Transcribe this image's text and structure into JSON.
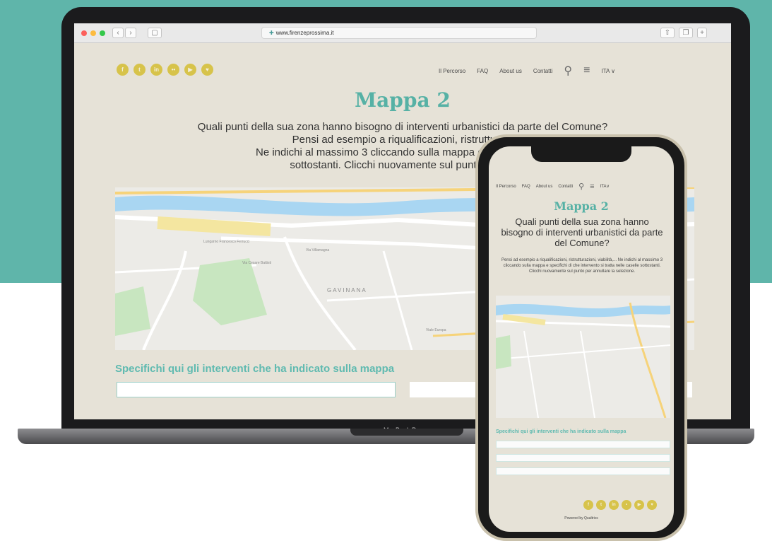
{
  "browser": {
    "url": "www.firenzeprossima.it"
  },
  "colors": {
    "accent": "#56b1a5",
    "social": "#d7c34a",
    "page_bg": "#e6e2d7",
    "teal_backdrop": "#5fb5aa"
  },
  "laptop": {
    "label": "MacBook Pro",
    "social_icons": [
      "facebook-icon",
      "twitter-icon",
      "linkedin-icon",
      "flickr-icon",
      "youtube-icon",
      "heart-icon"
    ],
    "nav": {
      "items": [
        "Il Percorso",
        "FAQ",
        "About us",
        "Contatti"
      ],
      "lang": "ITA",
      "lang_chevron": "∨"
    },
    "title": "Mappa 2",
    "text": {
      "line1": "Quali punti della sua zona hanno bisogno di interventi urbanistici da parte del Comune?",
      "line2": "Pensi ad esempio a riqualificazioni, ristrutturazi",
      "line3": "Ne indichi al massimo 3 cliccando sulla mappa e specifichi di c",
      "line4": "sottostanti. Clicchi nuovamente sul punto per an"
    },
    "map_labels": {
      "district": "GAVINANA",
      "street1": "Lungarno Francesco Ferrucci",
      "street2": "Via Villamagna",
      "street3": "Via Cesare Battisti",
      "street4": "Viale Europa"
    },
    "spec_label": "Specifichi qui gli interventi che ha indicato sulla mappa"
  },
  "phone": {
    "nav": {
      "items": [
        "Il Percorso",
        "FAQ",
        "About us",
        "Contatti"
      ],
      "lang": "ITA",
      "lang_chevron": "∨"
    },
    "title": "Mappa 2",
    "question": "Quali punti della sua zona hanno bisogno di interventi urbanistici da parte del Comune?",
    "body": "Pensi ad esempio a riqualificazioni, ristrutturazioni, viabilità,... Ne indichi al massimo 3 cliccando sulla mappa e specifichi di che intervento si tratta nelle caselle sottostanti. Clicchi nuovamente sul punto per annullare la selezione.",
    "spec_label": "Specifichi qui gli interventi che ha indicato sulla mappa",
    "powered": "Powered by Qualtrics",
    "social_icons": [
      "facebook-icon",
      "twitter-icon",
      "linkedin-icon",
      "flickr-icon",
      "youtube-icon",
      "heart-icon"
    ]
  }
}
